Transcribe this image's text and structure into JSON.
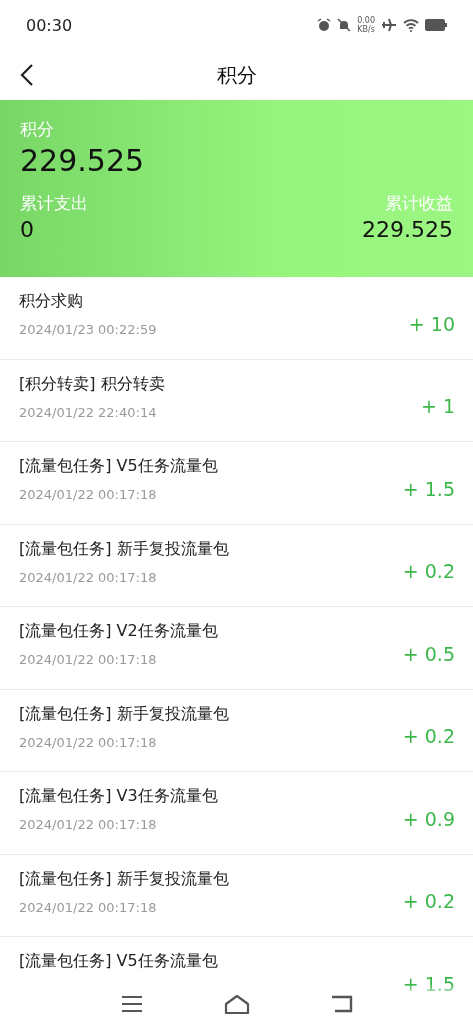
{
  "status_bar": {
    "time": "00:30",
    "speed_value": "0.00",
    "speed_unit": "KB/s"
  },
  "header": {
    "title": "积分"
  },
  "summary": {
    "label": "积分",
    "value": "229.525",
    "spent_label": "累计支出",
    "spent_value": "0",
    "earned_label": "累计收益",
    "earned_value": "229.525"
  },
  "records": [
    {
      "title": "积分求购",
      "date": "2024/01/23 00:22:59",
      "amount": "+ 10"
    },
    {
      "title": "[积分转卖] 积分转卖",
      "date": "2024/01/22 22:40:14",
      "amount": "+ 1"
    },
    {
      "title": "[流量包任务] V5任务流量包",
      "date": "2024/01/22 00:17:18",
      "amount": "+ 1.5"
    },
    {
      "title": "[流量包任务] 新手复投流量包",
      "date": "2024/01/22 00:17:18",
      "amount": "+ 0.2"
    },
    {
      "title": "[流量包任务] V2任务流量包",
      "date": "2024/01/22 00:17:18",
      "amount": "+ 0.5"
    },
    {
      "title": "[流量包任务] 新手复投流量包",
      "date": "2024/01/22 00:17:18",
      "amount": "+ 0.2"
    },
    {
      "title": "[流量包任务] V3任务流量包",
      "date": "2024/01/22 00:17:18",
      "amount": "+ 0.9"
    },
    {
      "title": "[流量包任务] 新手复投流量包",
      "date": "2024/01/22 00:17:18",
      "amount": "+ 0.2"
    },
    {
      "title": "[流量包任务] V5任务流量包",
      "amount": "+ 1.5"
    }
  ]
}
